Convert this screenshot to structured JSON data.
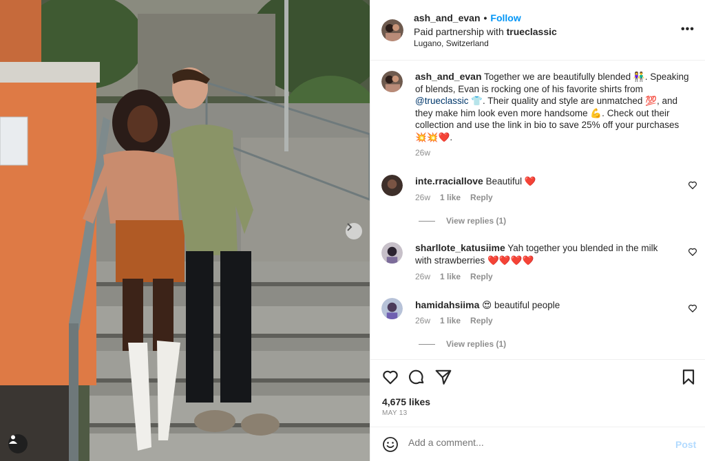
{
  "post": {
    "username": "ash_and_evan",
    "follow_label": "Follow",
    "partnership_prefix": "Paid partnership with ",
    "partner": "trueclassic",
    "location": "Lugano, Switzerland",
    "more_label": "•••",
    "caption_parts": {
      "p1": " Together we are beautifully blended 👫. Speaking of blends, Evan is rocking one of his favorite shirts from ",
      "mention": "@trueclassic",
      "p2": " 👕. Their quality and style are unmatched 💯, and they make him look even more handsome 💪. Check out their collection and use the link in bio to save 25% off your purchases 💥💥❤️."
    },
    "caption_time": "26w",
    "likes": "4,675 likes",
    "date": "MAY 13"
  },
  "comments": [
    {
      "username": "inte.rraciallove",
      "text": " Beautiful ❤️",
      "time": "26w",
      "likes": "1 like",
      "reply": "Reply",
      "view_replies": "View replies (1)"
    },
    {
      "username": "sharllote_katusiime",
      "text": " Yah together you blended in the milk with strawberries ❤️❤️❤️❤️",
      "time": "26w",
      "likes": "1 like",
      "reply": "Reply"
    },
    {
      "username": "hamidahsiima",
      "text": " 😍 beautiful people",
      "time": "26w",
      "likes": "1 like",
      "reply": "Reply",
      "view_replies": "View replies (1)"
    }
  ],
  "composer": {
    "placeholder": "Add a comment...",
    "post_label": "Post"
  },
  "colors": {
    "accent": "#0095f6",
    "post_disabled": "#b3dbff",
    "muted": "#8e8e8e",
    "mention": "#00376b"
  },
  "icons": [
    "user-tag-icon",
    "next-arrow-icon",
    "more-icon",
    "heart-icon",
    "comment-icon",
    "share-icon",
    "bookmark-icon",
    "emoji-icon"
  ]
}
